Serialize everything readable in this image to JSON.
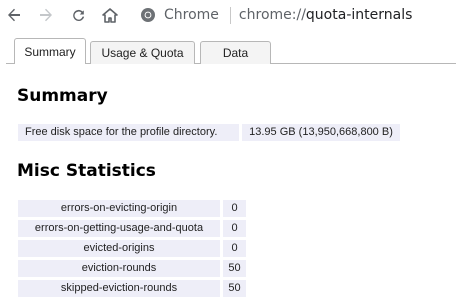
{
  "browser": {
    "chip_label": "Chrome",
    "url_scheme": "chrome://",
    "url_host": "quota-internals"
  },
  "tabs": [
    {
      "label": "Summary",
      "active": true
    },
    {
      "label": "Usage & Quota",
      "active": false
    },
    {
      "label": "Data",
      "active": false
    }
  ],
  "summary": {
    "title": "Summary",
    "rows": [
      {
        "key": "Free disk space for the profile directory.",
        "value": "13.95 GB (13,950,668,800 B)"
      }
    ]
  },
  "misc": {
    "title": "Misc Statistics",
    "rows": [
      {
        "key": "errors-on-evicting-origin",
        "value": "0"
      },
      {
        "key": "errors-on-getting-usage-and-quota",
        "value": "0"
      },
      {
        "key": "evicted-origins",
        "value": "0"
      },
      {
        "key": "eviction-rounds",
        "value": "50"
      },
      {
        "key": "skipped-eviction-rounds",
        "value": "50"
      }
    ]
  },
  "colors": {
    "cell_bg": "#eeeef8",
    "icon_gray": "#5f6368",
    "tab_border": "#b7b7b7"
  }
}
